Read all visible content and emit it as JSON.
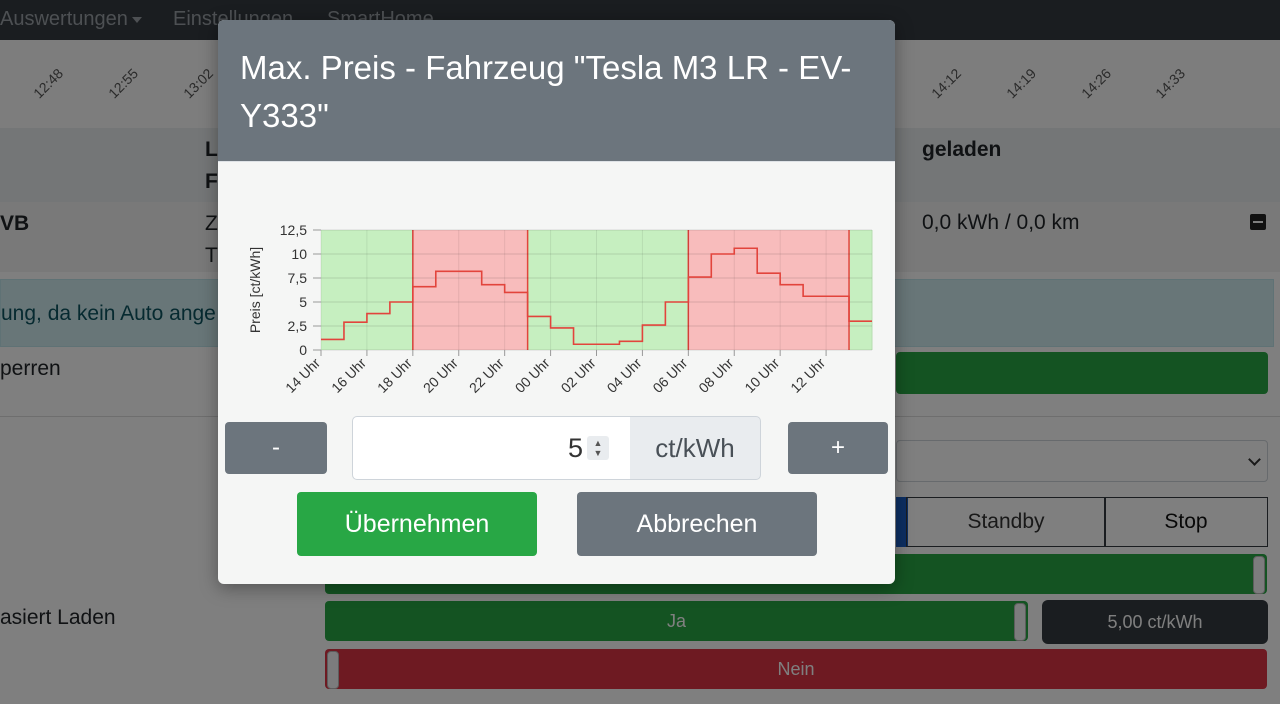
{
  "navbar": {
    "items": [
      "Auswertungen",
      "Einstellungen",
      "SmartHome"
    ]
  },
  "timeline": {
    "labels": [
      "12:48",
      "12:55",
      "13:02",
      "14:12",
      "14:19",
      "14:26",
      "14:33"
    ]
  },
  "table": {
    "header_col1": "L",
    "header_col1b": "F",
    "header_geladen": "geladen",
    "row_name": "VB",
    "row_col1": "Z",
    "row_col1b": "T",
    "row_geladen": "0,0 kWh / 0,0 km"
  },
  "alert": {
    "text": "ung, da kein Auto ange"
  },
  "labels": {
    "sperren": "perren",
    "preisbasiert": "asiert Laden"
  },
  "mode_buttons": {
    "standby": "Standby",
    "stop": "Stop"
  },
  "price_charging": {
    "ja": "Ja",
    "nein": "Nein",
    "price": "5,00 ct/kWh"
  },
  "modal": {
    "title": "Max. Preis - Fahrzeug \"Tesla M3 LR - EV-Y333\"",
    "minus_label": "-",
    "plus_label": "+",
    "input_value": "5",
    "unit": "ct/kWh",
    "ok_label": "Übernehmen",
    "cancel_label": "Abbrechen"
  },
  "colors": {
    "above_limit": "#f8bcbc",
    "below_limit": "#c6efc0",
    "price_line": "#e2443c",
    "ok_button": "#28a745",
    "secondary_button": "#6c757d"
  },
  "chart_data": {
    "type": "line",
    "ylabel": "Preis [ct/kWh]",
    "ylim": [
      0,
      12.5
    ],
    "yticks": [
      "0",
      "2,5",
      "5",
      "7,5",
      "10",
      "12,5"
    ],
    "xticks": [
      "14 Uhr",
      "16 Uhr",
      "18 Uhr",
      "20 Uhr",
      "22 Uhr",
      "00 Uhr",
      "02 Uhr",
      "04 Uhr",
      "06 Uhr",
      "08 Uhr",
      "10 Uhr",
      "12 Uhr"
    ],
    "limit": 5,
    "hours": [
      "14",
      "15",
      "16",
      "17",
      "18",
      "19",
      "20",
      "21",
      "22",
      "23",
      "00",
      "01",
      "02",
      "03",
      "04",
      "05",
      "06",
      "07",
      "08",
      "09",
      "10",
      "11",
      "12",
      "13"
    ],
    "values": [
      1.1,
      2.9,
      3.8,
      5.0,
      6.6,
      8.2,
      8.2,
      6.8,
      6.0,
      3.5,
      2.3,
      0.6,
      0.6,
      0.9,
      2.6,
      5.0,
      7.6,
      10.0,
      10.6,
      8.0,
      6.8,
      5.6,
      5.6,
      3.0
    ]
  }
}
